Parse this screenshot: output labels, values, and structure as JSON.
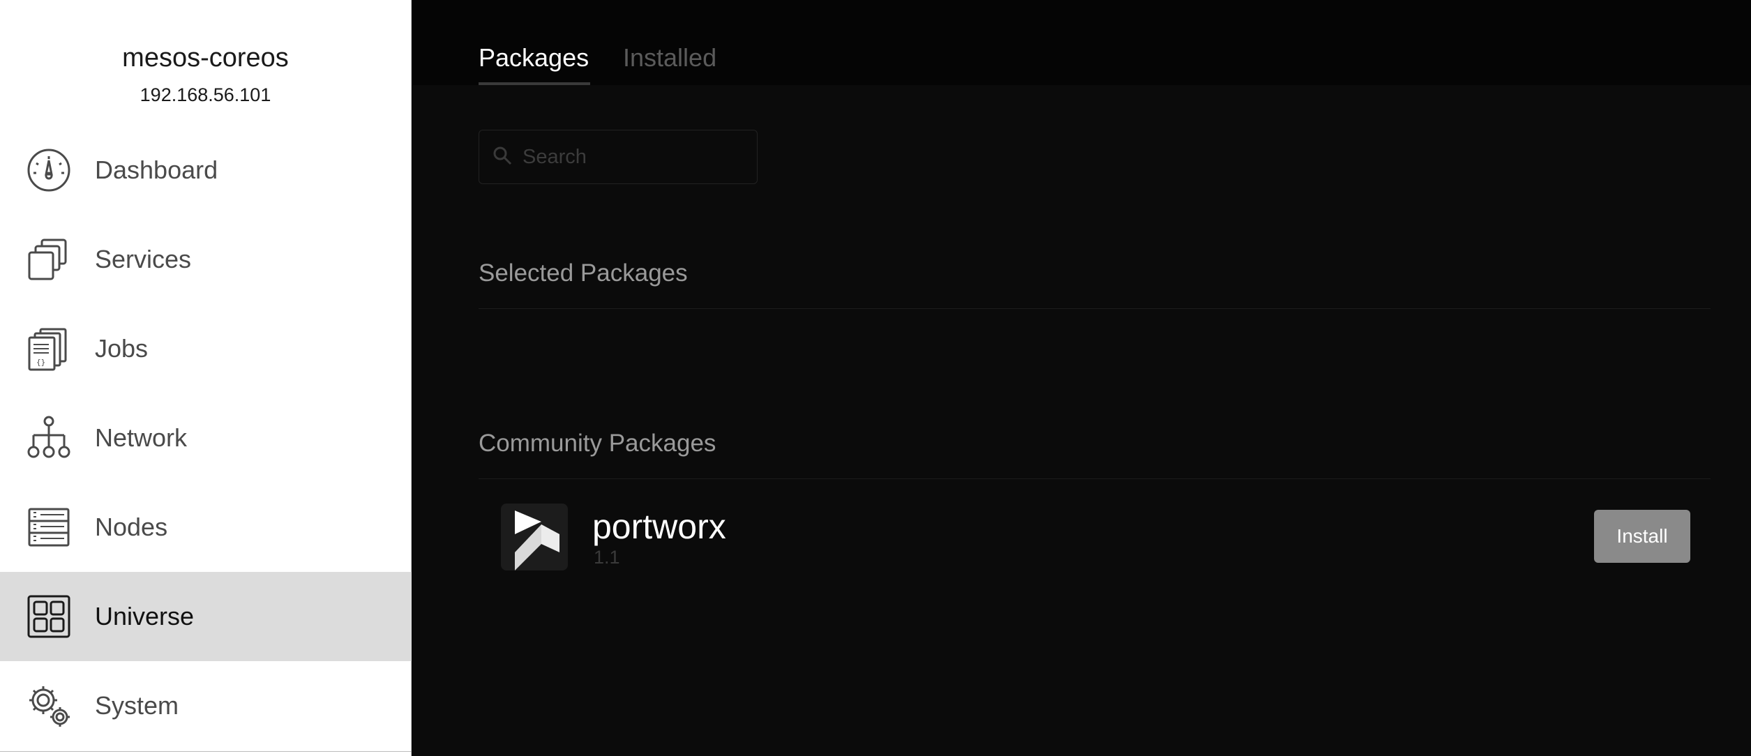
{
  "sidebar": {
    "cluster_name": "mesos-coreos",
    "cluster_ip": "192.168.56.101",
    "items": [
      {
        "label": "Dashboard",
        "icon": "dashboard-icon"
      },
      {
        "label": "Services",
        "icon": "services-icon"
      },
      {
        "label": "Jobs",
        "icon": "jobs-icon"
      },
      {
        "label": "Network",
        "icon": "network-icon"
      },
      {
        "label": "Nodes",
        "icon": "nodes-icon"
      },
      {
        "label": "Universe",
        "icon": "universe-icon",
        "active": true
      },
      {
        "label": "System",
        "icon": "system-icon"
      }
    ]
  },
  "tabs": {
    "packages": "Packages",
    "installed": "Installed",
    "active": "Packages"
  },
  "search": {
    "placeholder": "Search",
    "value": "",
    "icon": "search-icon"
  },
  "sections": {
    "selected": "Selected Packages",
    "community": "Community Packages"
  },
  "packages": [
    {
      "name": "portworx",
      "version": "1.1",
      "action": "Install",
      "icon": "portworx-logo"
    }
  ],
  "colors": {
    "sidebar_bg": "#ffffff",
    "sidebar_active": "#dcdcdc",
    "main_bg": "#0b0b0b",
    "button_bg": "#8a8a8a"
  }
}
